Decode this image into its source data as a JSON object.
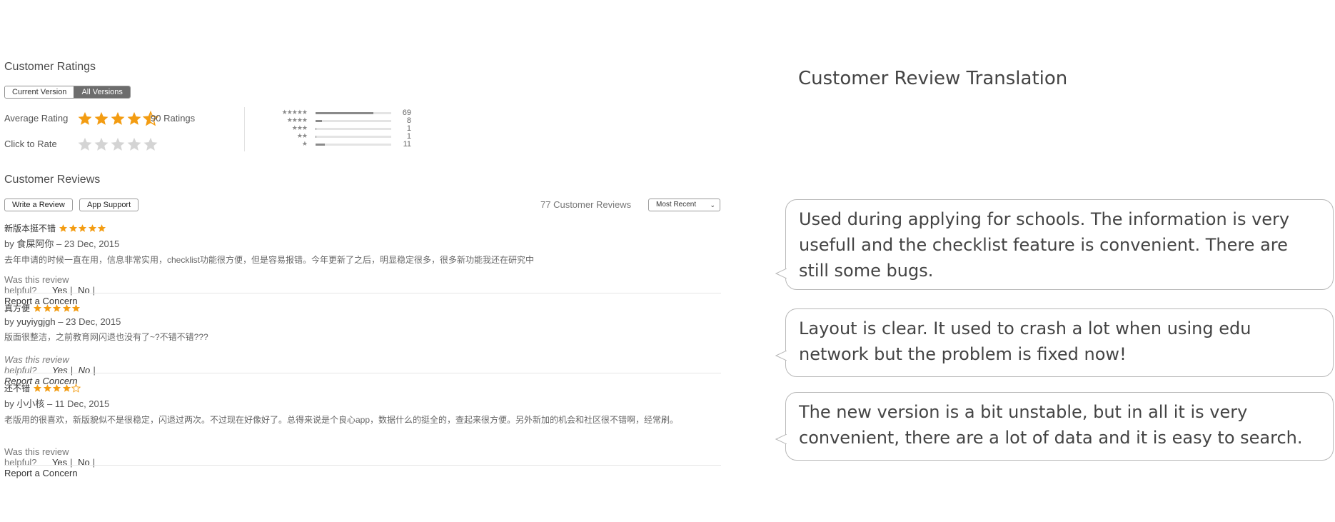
{
  "ratings": {
    "title": "Customer Ratings",
    "tabs": [
      "Current Version",
      "All Versions"
    ],
    "active_tab": "All Versions",
    "average_label": "Average Rating",
    "average_stars": 4.5,
    "ratings_count": "90 Ratings",
    "click_to_rate_label": "Click to Rate",
    "histogram": [
      {
        "stars": "★★★★★",
        "count": "69",
        "fraction": 0.767
      },
      {
        "stars": "★★★★",
        "count": "8",
        "fraction": 0.089
      },
      {
        "stars": "★★★",
        "count": "1",
        "fraction": 0.011
      },
      {
        "stars": "★★",
        "count": "1",
        "fraction": 0.011
      },
      {
        "stars": "★",
        "count": "11",
        "fraction": 0.122
      }
    ]
  },
  "reviews": {
    "title": "Customer Reviews",
    "write_button": "Write a Review",
    "support_button": "App Support",
    "count_text": "77 Customer Reviews",
    "sort_value": "Most Recent",
    "helpful_question": "Was this review helpful?",
    "yes_label": "Yes",
    "no_label": "No",
    "report_label": "Report a Concern",
    "items": [
      {
        "title": "新版本挺不错",
        "stars": 5,
        "by": "by",
        "author": "食屎阿你",
        "date": "– 23 Dec, 2015",
        "body": "去年申请的时候一直在用，信息非常实用，checklist功能很方便，但是容易报错。今年更新了之后，明显稳定很多，很多新功能我还在研究中"
      },
      {
        "title": "真方便",
        "stars": 5,
        "by": "by",
        "author": "yuyiygjgh",
        "date": "– 23 Dec, 2015",
        "body": "版面很整洁，之前教育网闪退也没有了~?不错不错???"
      },
      {
        "title": "还不错",
        "stars": 4,
        "by": "by",
        "author": "小小核",
        "date": "– 11 Dec, 2015",
        "body": "老版用的很喜欢，新版貌似不是很稳定，闪退过两次。不过现在好像好了。总得来说是个良心app，数据什么的挺全的，查起来很方便。另外新加的机会和社区很不错啊，经常刷。"
      }
    ]
  },
  "translation": {
    "title": "Customer Review Translation",
    "bubbles": [
      "Used during applying for schools. The information is very usefull and the checklist feature is convenient. There are still some bugs.",
      "Layout is clear. It used to crash a lot when using edu network but the problem is fixed now!",
      "The new version is a bit unstable, but in all it is very convenient, there are a lot of data and it is easy to search."
    ]
  },
  "colors": {
    "star_orange": "#f39c12",
    "star_empty": "#d4d4d4",
    "bubble_border": "#b8b8b8"
  },
  "icons": {
    "star": "star-icon",
    "chevron": "chevron-down-icon"
  }
}
